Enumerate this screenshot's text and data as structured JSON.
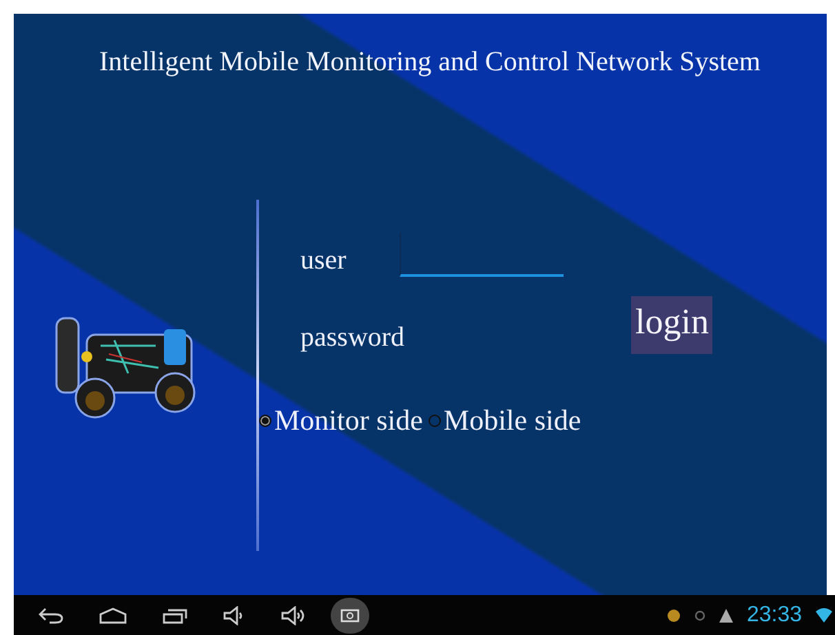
{
  "title": "Intelligent Mobile Monitoring and Control Network System",
  "form": {
    "user_label": "user",
    "password_label": "password",
    "login_button": "login"
  },
  "modes": [
    {
      "label": "Monitor side",
      "selected": true
    },
    {
      "label": "Mobile side",
      "selected": false
    }
  ],
  "navbar": {
    "time": "23:33"
  }
}
